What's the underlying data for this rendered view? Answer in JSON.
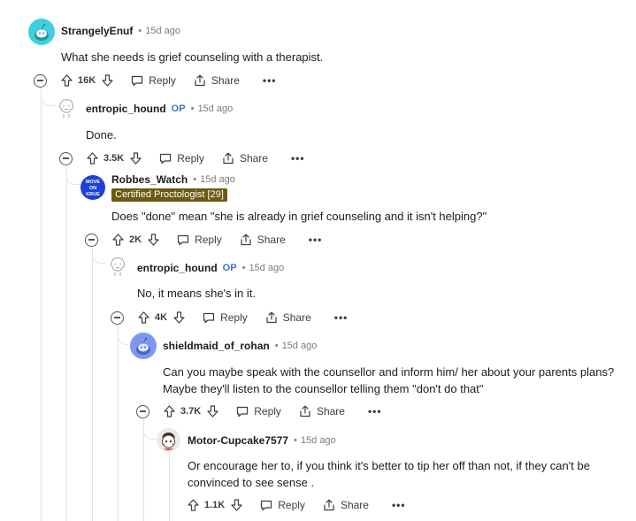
{
  "actions": {
    "reply": "Reply",
    "share": "Share",
    "more": "•••"
  },
  "comments": [
    {
      "user": "StrangelyEnuf",
      "op": "",
      "flair": "",
      "age": "15d ago",
      "text": [
        "What she needs is grief counseling with a therapist."
      ],
      "votes": "16K"
    },
    {
      "user": "entropic_hound",
      "op": "OP",
      "flair": "",
      "age": "15d ago",
      "text": [
        "Done."
      ],
      "votes": "3.5K"
    },
    {
      "user": "Robbes_Watch",
      "op": "",
      "flair": "Certified Proctologist [29]",
      "age": "15d ago",
      "text": [
        "Does \"done\" mean \"she is already in grief counseling and it isn't helping?\""
      ],
      "votes": "2K",
      "avatar_text": [
        "MOVE",
        "ON",
        "KRUE"
      ]
    },
    {
      "user": "entropic_hound",
      "op": "OP",
      "flair": "",
      "age": "15d ago",
      "text": [
        "No, it means she's in it."
      ],
      "votes": "4K"
    },
    {
      "user": "shieldmaid_of_rohan",
      "op": "",
      "flair": "",
      "age": "15d ago",
      "text": [
        "Can you maybe speak with the counsellor and inform him/ her about your parents plans?",
        "Maybe they'll listen to the counsellor telling them \"don't do that\""
      ],
      "votes": "3.7K"
    },
    {
      "user": "Motor-Cupcake7577",
      "op": "",
      "flair": "",
      "age": "15d ago",
      "text": [
        "Or encourage her to, if you think it's better to tip her off than not, if they can't be",
        "convinced to see sense ."
      ],
      "votes": "1.1K"
    }
  ],
  "colors": {
    "op": "#3b73cf",
    "flair_bg": "#6b5a12",
    "avatar_teal": "#3fd0e0",
    "avatar_blue": "#1c3fd8",
    "avatar_periwinkle": "#7f96f0"
  }
}
